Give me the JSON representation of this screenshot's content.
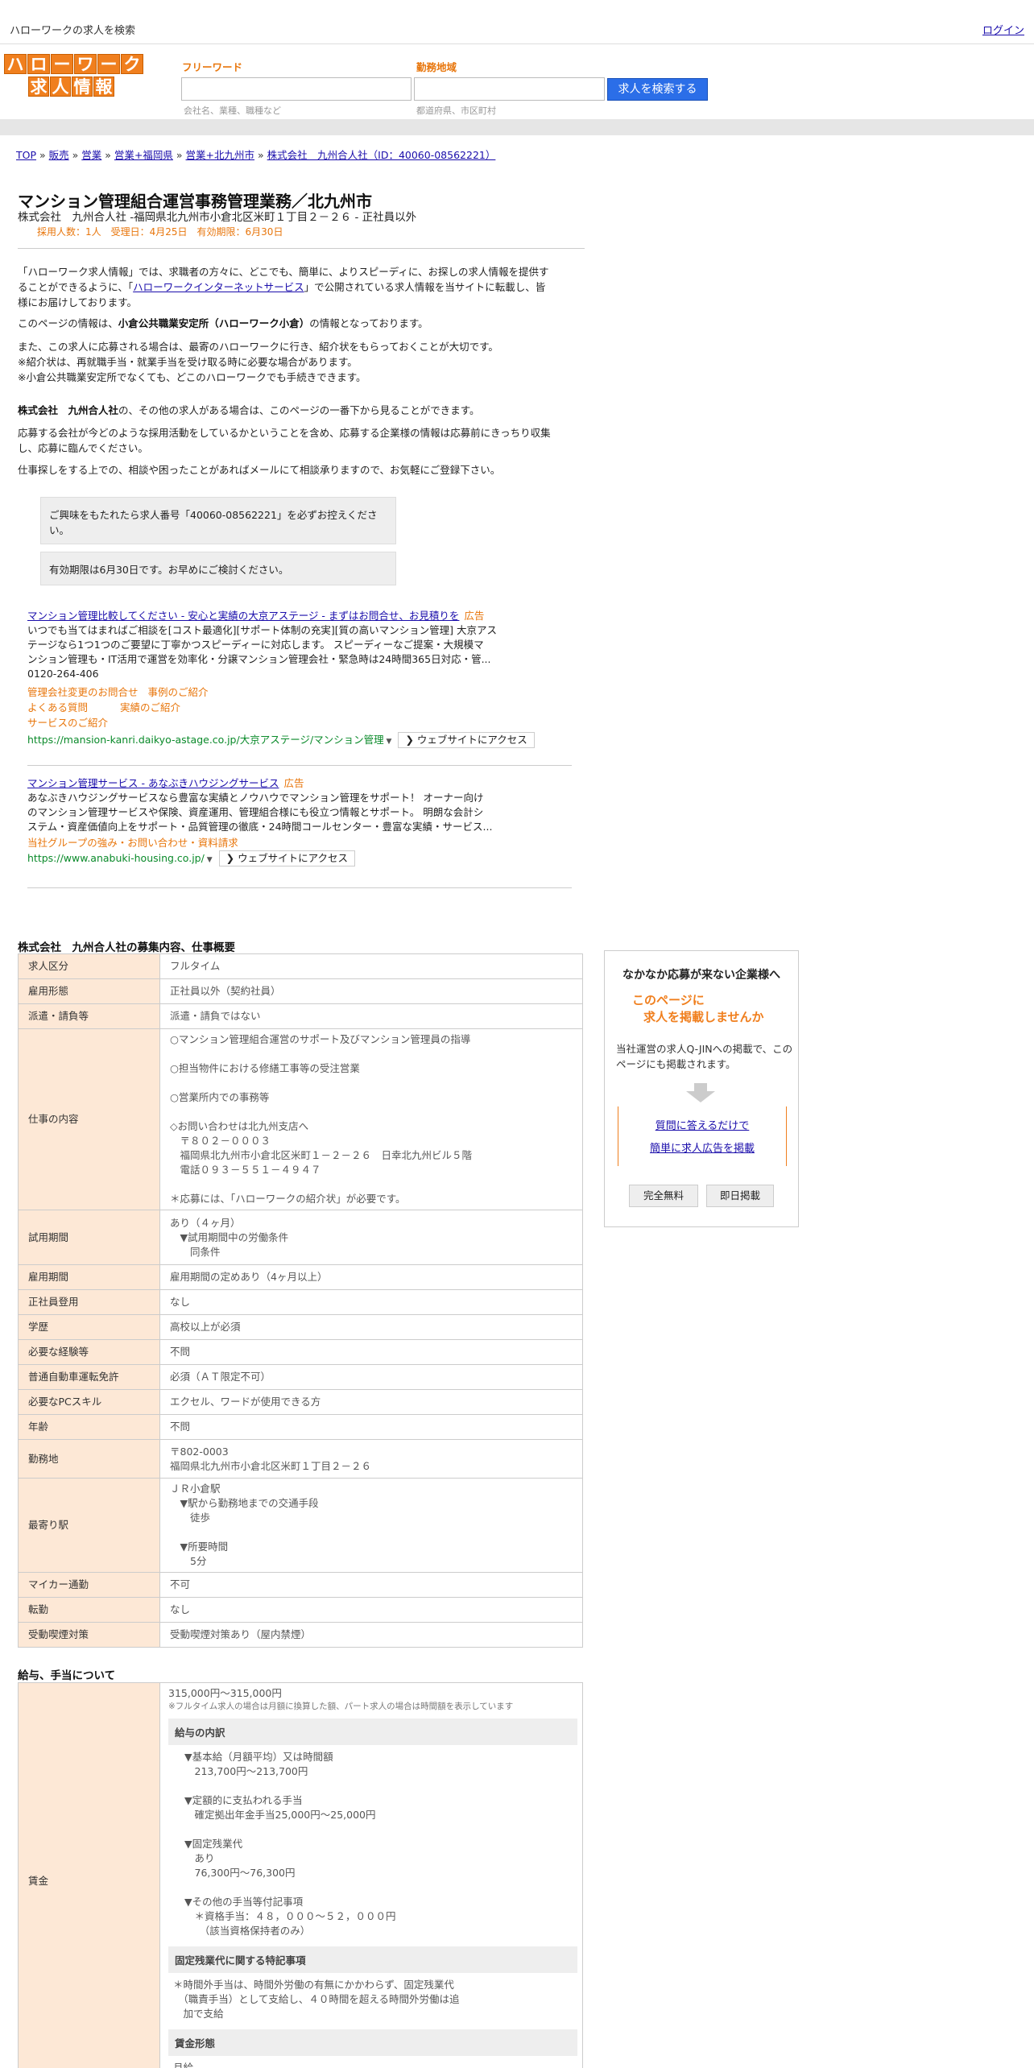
{
  "header": {
    "title": "ハローワークの求人を検索",
    "login": "ログイン"
  },
  "logo": {
    "row1": [
      "ハ",
      "ロ",
      "ー",
      "ワ",
      "ー",
      "ク"
    ],
    "row2": [
      "求",
      "人",
      "情",
      "報"
    ]
  },
  "search": {
    "keyword_label": "フリーワード",
    "keyword_hint": "会社名、業種、職種など",
    "area_label": "勤務地域",
    "area_hint": "都道府県、市区町村",
    "button": "求人を検索する"
  },
  "breadcrumb": [
    "TOP",
    "販売",
    "営業",
    "営業+福岡県",
    "営業+北九州市",
    "株式会社　九州合人社（ID：40060-08562221）"
  ],
  "job": {
    "title": "マンション管理組合運営事務管理業務／北九州市",
    "subtitle": "株式会社　九州合人社 -福岡県北九州市小倉北区米町１丁目２－２６ - 正社員以外",
    "meta": "採用人数：1人　受理日：4月25日　有効期限：6月30日"
  },
  "intro": {
    "p1_a": "「ハローワーク求人情報」では、求職者の方々に、どこでも、簡単に、よりスピーディに、お探しの求人情報を提供す",
    "p1_b": "ることができるように、「",
    "p1_link": "ハローワークインターネットサービス",
    "p1_c": "」で公開されている求人情報を当サイトに転載し、皆",
    "p1_d": "様にお届けしております。",
    "p2_a": "このページの情報は、",
    "p2_b": "小倉公共職業安定所（ハローワーク小倉）",
    "p2_c": "の情報となっております。",
    "p3_1": "また、この求人に応募される場合は、最寄のハローワークに行き、紹介状をもらっておくことが大切です。",
    "p3_2": "※紹介状は、再就職手当・就業手当を受け取る時に必要な場合があります。",
    "p3_3": "※小倉公共職業安定所でなくても、どこのハローワークでも手続きできます。",
    "p4_a": "株式会社　九州合人社",
    "p4_b": "の、その他の求人がある場合は、このページの一番下から見ることができます。",
    "p5_1": "応募する会社が今どのような採用活動をしているかということを含め、応募する企業様の情報は応募前にきっちり収集",
    "p5_2": "し、応募に臨んでください。",
    "p6": "仕事探しをする上での、相談や困ったことがあればメールにて相談承りますので、お気軽にご登録下さい。",
    "box1_1": "ご興味をもたれたら求人番号「40060-08562221」を必ずお控えくださ",
    "box1_2": "い。",
    "box2": "有効期限は6月30日です。お早めにご検討ください。"
  },
  "ads": [
    {
      "title": "マンション管理比較してください - 安心と実績の大京アステージ - まずはお問合せ、お見積りを",
      "tag": "広告",
      "desc1": "いつでも当てはまればご相談を[コスト最適化][サポート体制の充実][質の高いマンション管理] 大京アス",
      "desc2": "テージなら1つ1つのご要望に丁寧かつスピーディーに対応します。 スピーディーなご提案・大規模マ",
      "desc3": "ンション管理も・IT活用で運営を効率化・分譲マンション管理会社・緊急時は24時間365日対応・管...",
      "phone": "0120-264-406",
      "links": [
        "管理会社変更のお問合せ",
        "事例のご紹介",
        "よくある質問",
        "実績のご紹介",
        "サービスのご紹介"
      ],
      "url": "https://mansion-kanri.daikyo-astage.co.jp/大京アステージ/マンション管理",
      "button": "❯ ウェブサイトにアクセス"
    },
    {
      "title": "マンション管理サービス - あなぶきハウジングサービス",
      "tag": "広告",
      "desc1": "あなぶきハウジングサービスなら豊富な実績とノウハウでマンション管理をサポート！ オーナー向け",
      "desc2": "のマンション管理サービスや保険、資産運用、管理組合様にも役立つ情報とサポート。 明朗な会計シ",
      "desc3": "ステム・資産価値向上をサポート・品質管理の徹底・24時間コールセンター・豊富な実績・サービス...",
      "links": [
        "当社グループの強み・お問い合わせ・資料請求"
      ],
      "url": "https://www.anabuki-housing.co.jp/",
      "button": "❯ ウェブサイトにアクセス"
    }
  ],
  "section1": "株式会社　九州合人社の募集内容、仕事概要",
  "rows": [
    {
      "k": "求人区分",
      "v": "フルタイム"
    },
    {
      "k": "雇用形態",
      "v": "正社員以外（契約社員）"
    },
    {
      "k": "派遣・請負等",
      "v": "派遣・請負ではない"
    },
    {
      "k": "仕事の内容",
      "v": "○マンション管理組合運営のサポート及びマンション管理員の指導\n\n○担当物件における修繕工事等の受注営業\n\n○営業所内での事務等\n\n◇お問い合わせは北九州支店へ\n　〒８０２－０００３\n　福岡県北九州市小倉北区米町１－２－２６　日幸北九州ビル５階\n　電話０９３－５５１－４９４７\n\n＊応募には、「ハローワークの紹介状」が必要です。"
    },
    {
      "k": "試用期間",
      "v": "あり（４ヶ月）\n　▼試用期間中の労働条件\n　　同条件"
    },
    {
      "k": "雇用期間",
      "v": "雇用期間の定めあり（4ヶ月以上）"
    },
    {
      "k": "正社員登用",
      "v": "なし"
    },
    {
      "k": "学歴",
      "v": "高校以上が必須"
    },
    {
      "k": "必要な経験等",
      "v": "不問"
    },
    {
      "k": "普通自動車運転免許",
      "v": "必須（ＡＴ限定不可）"
    },
    {
      "k": "必要なPCスキル",
      "v": "エクセル、ワードが使用できる方"
    },
    {
      "k": "年齢",
      "v": "不問"
    },
    {
      "k": "勤務地",
      "v": "〒802-0003\n福岡県北九州市小倉北区米町１丁目２－２６"
    },
    {
      "k": "最寄り駅",
      "v": "ＪＲ小倉駅\n　▼駅から勤務地までの交通手段\n　　徒歩\n\n　▼所要時間\n　　5分"
    },
    {
      "k": "マイカー通勤",
      "v": "不可"
    },
    {
      "k": "転勤",
      "v": "なし"
    },
    {
      "k": "受動喫煙対策",
      "v": "受動喫煙対策あり（屋内禁煙）"
    }
  ],
  "sidebar": {
    "heading": "なかなか応募が来ない企業様へ",
    "orange1": "このページに",
    "orange2": "求人を掲載しませんか",
    "desc": "当社運営の求人Q-JINへの掲載で、このページにも掲載されます。",
    "link1": "質問に答えるだけで",
    "link2": "簡単に求人広告を掲載",
    "btn1": "完全無料",
    "btn2": "即日掲載"
  },
  "section2": "給与、手当について",
  "salary": {
    "key": "賃金",
    "amount": "315,000円〜315,000円",
    "note": "※フルタイム求人の場合は月額に換算した額、パート求人の場合は時間額を表示しています",
    "h_breakdown": "給与の内訳",
    "breakdown": "▼基本給（月額平均）又は時間額\n　213,700円〜213,700円\n\n▼定額的に支払われる手当\n　確定拠出年金手当25,000円〜25,000円\n\n▼固定残業代\n　あり\n　76,300円〜76,300円\n\n▼その他の手当等付記事項\n　＊資格手当：４８，０００～５２，０００円\n　　（該当資格保持者のみ）",
    "h_fixed": "固定残業代に関する特記事項",
    "fixed": "＊時間外手当は、時間外労働の有無にかかわらず、固定残業代\n　（職責手当）として支給し、４０時間を超える時間外労働は追\n　加で支給",
    "h_form": "賃金形態",
    "form": "月給"
  }
}
